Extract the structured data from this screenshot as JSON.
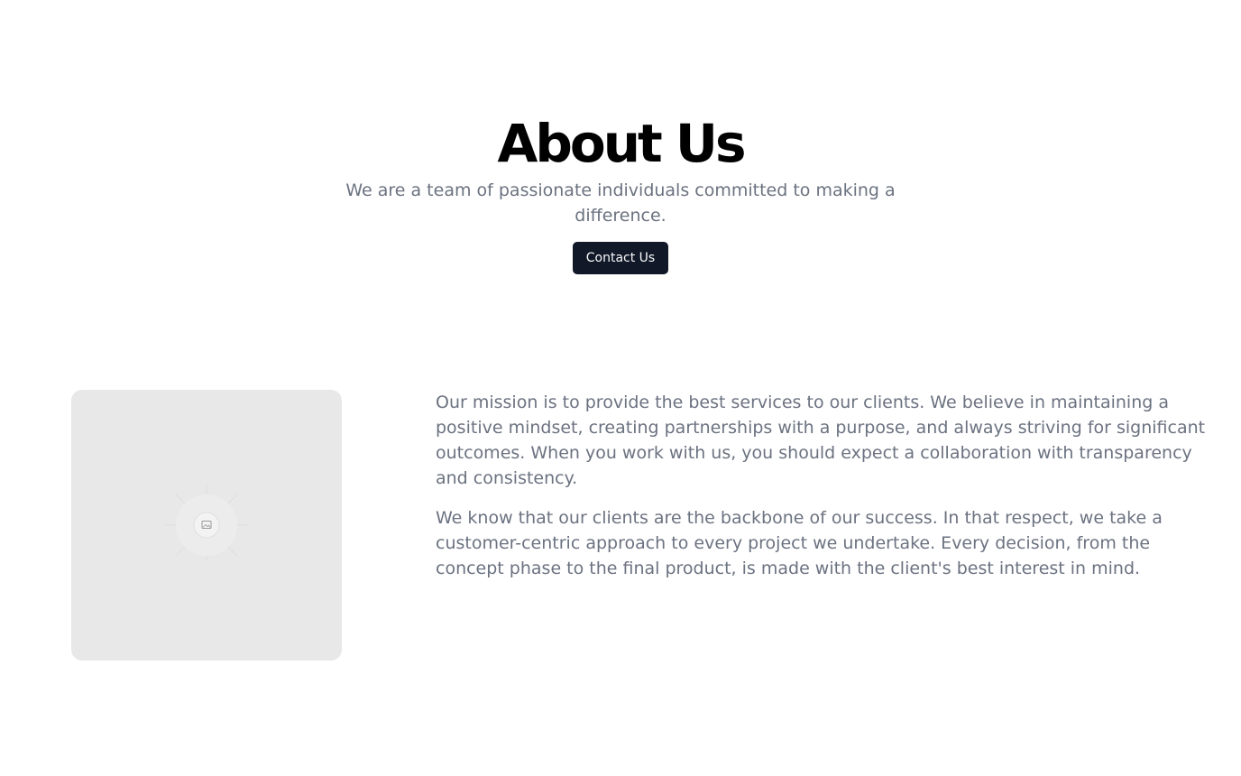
{
  "hero": {
    "title": "About Us",
    "subtitle": "We are a team of passionate individuals committed to making a difference.",
    "cta_label": "Contact Us"
  },
  "about": {
    "image_icon": "image-placeholder-icon",
    "paragraphs": [
      "Our mission is to provide the best services to our clients. We believe in maintaining a positive mindset, creating partnerships with a purpose, and always striving for significant outcomes. When you work with us, you should expect a collaboration with transparency and consistency.",
      "We know that our clients are the backbone of our success. In that respect, we take a customer-centric approach to every project we undertake. Every decision, from the concept phase to the final product, is made with the client's best interest in mind."
    ]
  },
  "colors": {
    "heading": "#000000",
    "body_text": "#6b7280",
    "button_bg": "#111827",
    "button_text": "#f9fafb",
    "placeholder_bg": "#e8e8e8"
  }
}
